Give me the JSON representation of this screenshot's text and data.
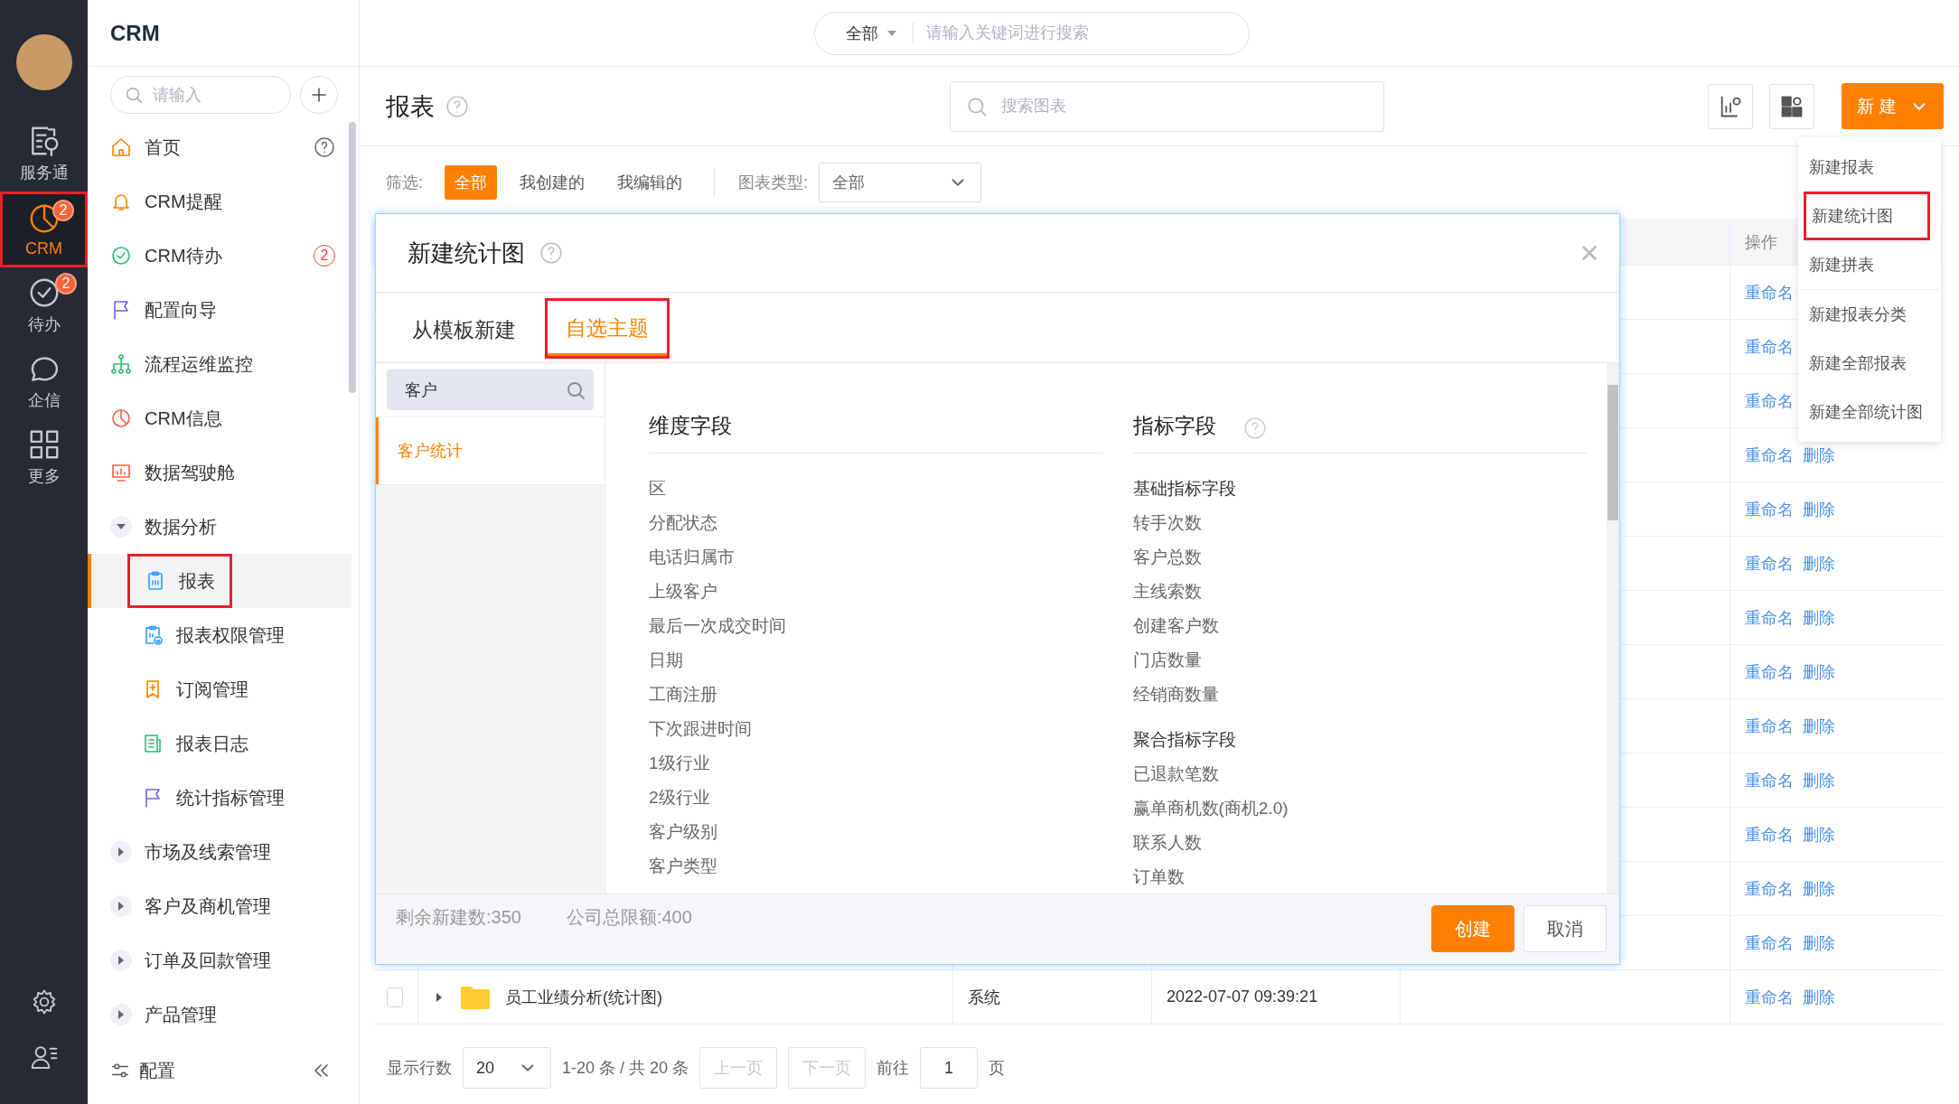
{
  "rail": {
    "items": [
      {
        "label": "服务通",
        "selected": false,
        "annotated": false
      },
      {
        "label": "CRM",
        "selected": true,
        "annotated": true,
        "badge": "2"
      },
      {
        "label": "待办",
        "selected": false,
        "annotated": false,
        "badge": "2"
      },
      {
        "label": "企信",
        "selected": false,
        "annotated": false
      },
      {
        "label": "更多",
        "selected": false,
        "annotated": false
      }
    ]
  },
  "sidebar": {
    "title": "CRM",
    "search": {
      "placeholder": "请输入"
    },
    "items": [
      {
        "kind": "link",
        "label": "首页",
        "selected": false,
        "annotated": false,
        "help": true
      },
      {
        "kind": "link",
        "label": "CRM提醒",
        "selected": false,
        "annotated": false
      },
      {
        "kind": "link",
        "label": "CRM待办",
        "selected": false,
        "annotated": false,
        "badge": "2"
      },
      {
        "kind": "link",
        "label": "配置向导",
        "selected": false,
        "annotated": false
      },
      {
        "kind": "link",
        "label": "流程运维监控",
        "selected": false,
        "annotated": false
      },
      {
        "kind": "link",
        "label": "CRM信息",
        "selected": false,
        "annotated": false
      },
      {
        "kind": "link",
        "label": "数据驾驶舱",
        "selected": false,
        "annotated": false
      },
      {
        "kind": "group",
        "label": "数据分析",
        "expanded": true,
        "children": [
          {
            "kind": "link",
            "label": "报表",
            "selected": true,
            "annotated": true
          },
          {
            "kind": "link",
            "label": "报表权限管理",
            "selected": false,
            "annotated": false
          },
          {
            "kind": "link",
            "label": "订阅管理",
            "selected": false,
            "annotated": false
          },
          {
            "kind": "link",
            "label": "报表日志",
            "selected": false,
            "annotated": false
          },
          {
            "kind": "link",
            "label": "统计指标管理",
            "selected": false,
            "annotated": false
          }
        ]
      },
      {
        "kind": "group",
        "label": "市场及线索管理",
        "expanded": false
      },
      {
        "kind": "group",
        "label": "客户及商机管理",
        "expanded": false
      },
      {
        "kind": "group",
        "label": "订单及回款管理",
        "expanded": false
      },
      {
        "kind": "group",
        "label": "产品管理",
        "expanded": false
      }
    ],
    "footer": "配置"
  },
  "topbar": {
    "scope": "全部",
    "placeholder": "请输入关键词进行搜索"
  },
  "page": {
    "title": "报表",
    "search_placeholder": "搜索图表",
    "new_button": "新建"
  },
  "filters": {
    "label": "筛选:",
    "options": [
      {
        "label": "全部",
        "selected": true
      },
      {
        "label": "我创建的",
        "selected": false
      },
      {
        "label": "我编辑的",
        "selected": false
      }
    ],
    "type_label": "图表类型:",
    "type_value": "全部"
  },
  "menu": {
    "sections": [
      [
        {
          "label": "新建报表",
          "annotated": false
        },
        {
          "label": "新建统计图",
          "annotated": true
        },
        {
          "label": "新建拼表",
          "annotated": false
        }
      ],
      [
        {
          "label": "新建报表分类",
          "annotated": false
        },
        {
          "label": "新建全部报表",
          "annotated": false
        },
        {
          "label": "新建全部统计图",
          "annotated": false
        }
      ]
    ]
  },
  "table": {
    "action_header": "操作",
    "rows": [
      {
        "actions": [
          "重命名"
        ]
      },
      {
        "actions": [
          "重命名"
        ]
      },
      {
        "actions": [
          "重命名"
        ]
      },
      {
        "actions": [
          "重命名",
          "删除"
        ]
      },
      {
        "actions": [
          "重命名",
          "删除"
        ]
      },
      {
        "actions": [
          "重命名",
          "删除"
        ]
      },
      {
        "actions": [
          "重命名",
          "删除"
        ]
      },
      {
        "actions": [
          "重命名",
          "删除"
        ]
      },
      {
        "actions": [
          "重命名",
          "删除"
        ]
      },
      {
        "actions": [
          "重命名",
          "删除"
        ]
      },
      {
        "actions": [
          "重命名",
          "删除"
        ]
      },
      {
        "actions": [
          "重命名",
          "删除"
        ]
      },
      {
        "actions": [
          "重命名",
          "删除"
        ]
      },
      {
        "checked": false,
        "expanded": false,
        "name": "员工业绩分析(统计图)",
        "creator": "系统",
        "time": "2022-07-07 09:39:21",
        "actions": [
          "重命名",
          "删除"
        ]
      }
    ]
  },
  "pagination": {
    "rows_label": "显示行数",
    "page_size": "20",
    "range": "1-20 条 / 共 20 条",
    "prev": {
      "label": "上一页",
      "disabled": true
    },
    "next": {
      "label": "下一页",
      "disabled": true
    },
    "goto_label": "前往",
    "page": "1",
    "page_suffix": "页"
  },
  "modal": {
    "title": "新建统计图",
    "tabs": [
      {
        "label": "从模板新建",
        "selected": false,
        "annotated": false
      },
      {
        "label": "自选主题",
        "selected": true,
        "annotated": true
      }
    ],
    "search_value": "客户",
    "topics": [
      {
        "label": "客户统计",
        "selected": true
      }
    ],
    "dimension": {
      "title": "维度字段",
      "items": [
        "区",
        "分配状态",
        "电话归属市",
        "上级客户",
        "最后一次成交时间",
        "日期",
        "工商注册",
        "下次跟进时间",
        "1级行业",
        "2级行业",
        "客户级别",
        "客户类型"
      ]
    },
    "metric": {
      "title": "指标字段",
      "groups": [
        {
          "title": "基础指标字段",
          "items": [
            "转手次数",
            "客户总数",
            "主线索数",
            "创建客户数",
            "门店数量",
            "经销商数量"
          ]
        },
        {
          "title": "聚合指标字段",
          "items": [
            "已退款笔数",
            "赢单商机数(商机2.0)",
            "联系人数",
            "订单数"
          ]
        }
      ]
    },
    "remaining": "剩余新建数:350",
    "quota": "公司总限额:400",
    "buttons": [
      {
        "label": "创建",
        "kind": "primary"
      },
      {
        "label": "取消",
        "kind": "default"
      }
    ]
  }
}
